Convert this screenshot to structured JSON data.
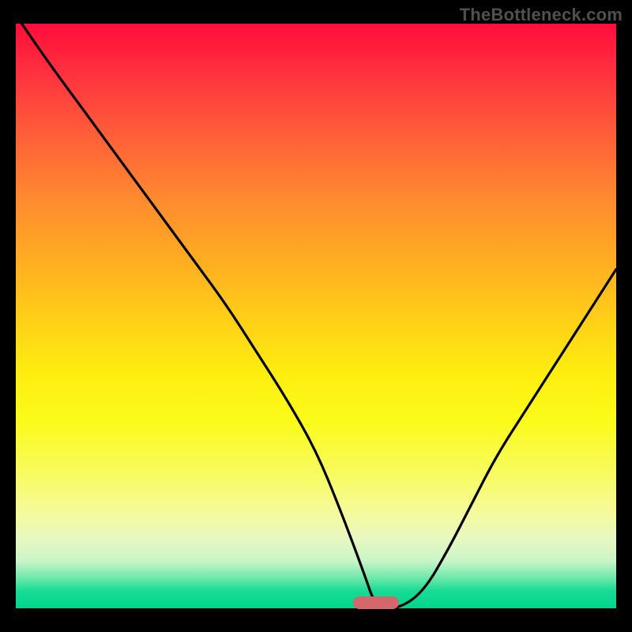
{
  "watermark": "TheBottleneck.com",
  "chart_data": {
    "type": "line",
    "title": "",
    "xlabel": "",
    "ylabel": "",
    "xlim": [
      0,
      100
    ],
    "ylim": [
      0,
      100
    ],
    "grid": false,
    "legend": false,
    "series": [
      {
        "name": "bottleneck-curve",
        "x": [
          1,
          5,
          10,
          15,
          20,
          25,
          30,
          35,
          40,
          45,
          50,
          54,
          58,
          60,
          64,
          68,
          72,
          76,
          80,
          85,
          90,
          95,
          100
        ],
        "y": [
          100,
          94,
          87,
          80,
          73,
          66,
          59,
          52,
          44,
          36,
          27,
          17,
          6,
          0,
          0,
          3,
          10,
          18,
          26,
          34,
          42,
          50,
          58
        ]
      }
    ],
    "marker": {
      "x": 60,
      "y": 1,
      "color": "#d4676b"
    },
    "gradient_stops": [
      {
        "pct": 0,
        "color": "#ff0d3a"
      },
      {
        "pct": 50,
        "color": "#ffd416"
      },
      {
        "pct": 70,
        "color": "#fbfb1a"
      },
      {
        "pct": 95,
        "color": "#67e7a8"
      },
      {
        "pct": 100,
        "color": "#00d68b"
      }
    ]
  }
}
